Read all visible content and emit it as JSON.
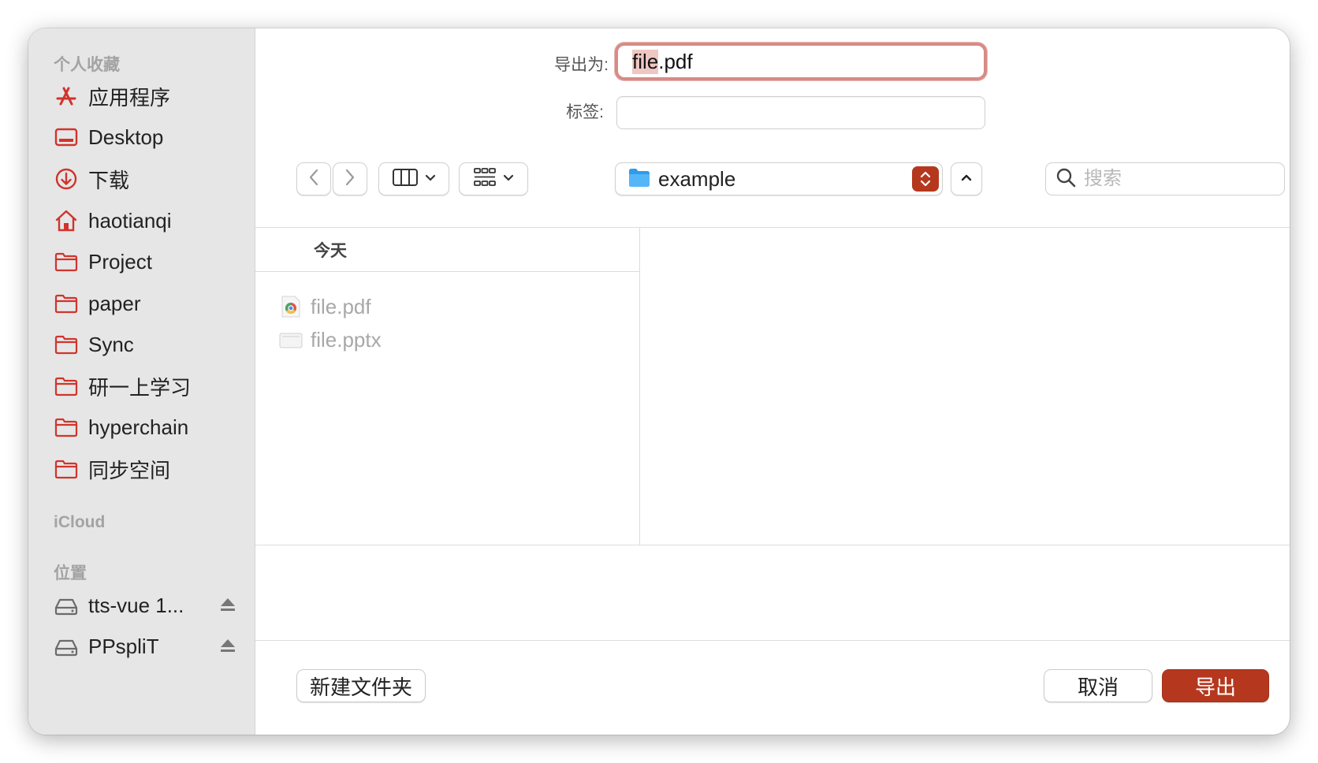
{
  "colors": {
    "accent": "#b5381e",
    "sidebar_icon": "#d0342c",
    "sidebar_bg": "#e6e6e6",
    "focus_ring": "#d88b86"
  },
  "form": {
    "export_as_label": "导出为:",
    "filename_selected": "file",
    "filename_rest": ".pdf",
    "tags_label": "标签:",
    "tags_value": ""
  },
  "toolbar": {
    "back_icon": "chevron-left-icon",
    "forward_icon": "chevron-right-icon",
    "view_mode_icon": "columns-view-icon",
    "group_icon": "grid-icon",
    "location": "example",
    "search_placeholder": "搜索"
  },
  "sidebar": {
    "favorites_header": "个人收藏",
    "favorites": [
      {
        "label": "应用程序",
        "icon": "applications-icon"
      },
      {
        "label": "Desktop",
        "icon": "desktop-icon"
      },
      {
        "label": "下载",
        "icon": "download-icon"
      },
      {
        "label": "haotianqi",
        "icon": "home-icon"
      },
      {
        "label": "Project",
        "icon": "folder-icon"
      },
      {
        "label": "paper",
        "icon": "folder-icon"
      },
      {
        "label": "Sync",
        "icon": "folder-icon"
      },
      {
        "label": "研一上学习",
        "icon": "folder-icon"
      },
      {
        "label": "hyperchain",
        "icon": "folder-icon"
      },
      {
        "label": "同步空间",
        "icon": "folder-icon"
      }
    ],
    "icloud_header": "iCloud",
    "locations_header": "位置",
    "locations": [
      {
        "label": "tts-vue 1...",
        "icon": "disk-icon"
      },
      {
        "label": "PPspliT",
        "icon": "disk-icon"
      }
    ]
  },
  "browser": {
    "group_header": "今天",
    "files": [
      {
        "name": "file.pdf",
        "icon": "chrome-pdf-icon"
      },
      {
        "name": "file.pptx",
        "icon": "document-icon"
      }
    ]
  },
  "actions": {
    "new_folder": "新建文件夹",
    "cancel": "取消",
    "export": "导出"
  }
}
